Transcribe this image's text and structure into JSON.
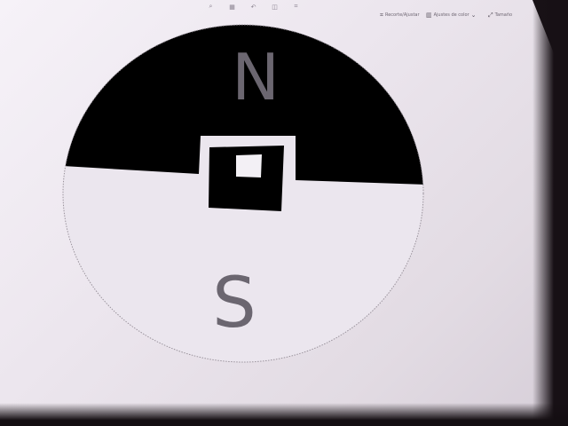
{
  "toolbar": {
    "icons": [
      "search-icon",
      "grid-icon",
      "undo-icon",
      "layers-icon",
      "crop-icon"
    ],
    "items": [
      {
        "icon": "crop-icon",
        "label": "Recorte/Ajustar"
      },
      {
        "icon": "layout-icon",
        "label": "Ajustes de color"
      },
      {
        "icon": "resize-icon",
        "label": "Tamaño"
      }
    ]
  },
  "diagram": {
    "north_label": "N",
    "south_label": "S",
    "colors": {
      "north_fill": "#000000",
      "south_fill": "#e9e4ec",
      "label": "#6b6670",
      "outline": "#9a939c"
    }
  }
}
